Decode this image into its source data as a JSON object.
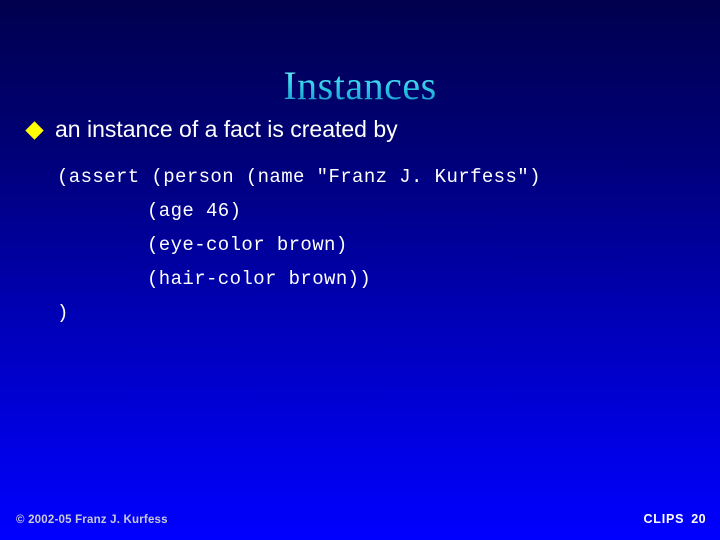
{
  "slide": {
    "title": "Instances",
    "background": {
      "top_color": "#00004e",
      "bottom_color": "#0000ff"
    },
    "title_gradient": {
      "top_color": "#7ef2fb",
      "bottom_color": "#1f7fc4"
    }
  },
  "bullet": {
    "marker": "diamond-bullet",
    "marker_color": "#ffff00",
    "text": "an instance of a fact is created by"
  },
  "code": {
    "color": "#ffffff",
    "lines": [
      {
        "text": "(assert (person (name \"Franz J. Kurfess\")",
        "indented": false
      },
      {
        "text": "(age 46)",
        "indented": true
      },
      {
        "text": "(eye-color brown)",
        "indented": true
      },
      {
        "text": "(hair-color brown))",
        "indented": true
      },
      {
        "text": ")",
        "indented": false
      }
    ]
  },
  "footer": {
    "copyright": "© 2002-05 Franz J. Kurfess",
    "course": "CLIPS",
    "page_number": "20"
  }
}
